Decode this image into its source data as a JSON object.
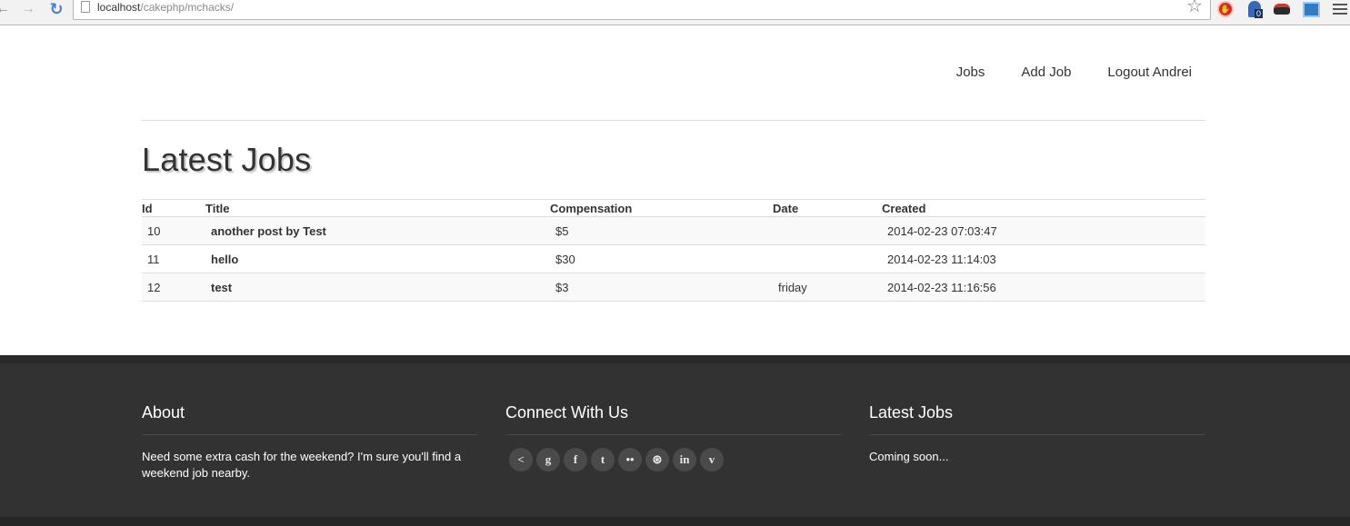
{
  "browser": {
    "url_host": "localhost",
    "url_path": "/cakephp/mchacks/",
    "extension_badge": "0"
  },
  "nav": {
    "links": [
      "Jobs",
      "Add Job",
      "Logout Andrei"
    ]
  },
  "main": {
    "heading": "Latest Jobs",
    "table": {
      "headers": [
        "Id",
        "Title",
        "Compensation",
        "Date",
        "Created"
      ],
      "rows": [
        {
          "id": "10",
          "title": "another post by Test",
          "compensation": "$5",
          "date": "",
          "created": "2014-02-23 07:03:47"
        },
        {
          "id": "11",
          "title": "hello",
          "compensation": "$30",
          "date": "",
          "created": "2014-02-23 11:14:03"
        },
        {
          "id": "12",
          "title": "test",
          "compensation": "$3",
          "date": "friday",
          "created": "2014-02-23 11:16:56"
        }
      ]
    }
  },
  "footer": {
    "about": {
      "title": "About",
      "text": "Need some extra cash for the weekend? I'm sure you'll find a weekend job nearby."
    },
    "connect": {
      "title": "Connect With Us",
      "icons": [
        {
          "name": "share-icon",
          "glyph": "<"
        },
        {
          "name": "google-icon",
          "glyph": "g"
        },
        {
          "name": "facebook-icon",
          "glyph": "f"
        },
        {
          "name": "twitter-icon",
          "glyph": "t"
        },
        {
          "name": "flickr-icon",
          "glyph": "••"
        },
        {
          "name": "dribbble-icon",
          "glyph": "⊛"
        },
        {
          "name": "linkedin-icon",
          "glyph": "in"
        },
        {
          "name": "vimeo-icon",
          "glyph": "v"
        }
      ]
    },
    "latest": {
      "title": "Latest Jobs",
      "text": "Coming soon..."
    }
  },
  "colors": {
    "footer_bg": "#323232",
    "text": "#333333",
    "row_stripe": "#f9f9f9"
  }
}
